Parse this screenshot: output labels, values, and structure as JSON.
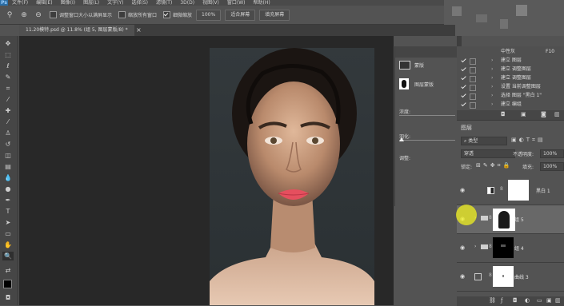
{
  "app": {
    "logo": "Ps"
  },
  "menu": [
    "文件(F)",
    "编辑(E)",
    "图像(I)",
    "图层(L)",
    "文字(Y)",
    "选择(S)",
    "滤镜(T)",
    "3D(D)",
    "视图(V)",
    "窗口(W)",
    "帮助(H)"
  ],
  "options": {
    "resize_windows_label": "调整窗口大小以满屏显示",
    "resize_windows_checked": false,
    "zoom_all_label": "缩放所有窗口",
    "zoom_all_checked": false,
    "scrubby_zoom_label": "细微缩放",
    "scrubby_zoom_checked": true,
    "zoom_value": "100%",
    "fit_screen": "适合屏幕",
    "fill_screen": "填充屏幕"
  },
  "document": {
    "tab": "11.20模特.psd @ 11.8% (组 5, 图层蒙版/8) *"
  },
  "properties": {
    "mask_tab": "蒙版",
    "layer_mask_label": "图层蒙版",
    "density_label": "浓度:",
    "feather_label": "羽化:",
    "adjust_label": "调整:"
  },
  "history": {
    "top_label": "中性灰",
    "top_value": "F10",
    "items": [
      "建立 图层",
      "建立 调整图层",
      "建立 调整图层",
      "设置 当前调整图层",
      "选择 图层 \"黑白 1\"",
      "建立 编组"
    ]
  },
  "layers_panel": {
    "title": "图层",
    "filter_kind": "类型",
    "blend_mode": "穿透",
    "opacity_label": "不透明度:",
    "opacity_value": "100%",
    "lock_label": "锁定:",
    "fill_label": "填充:",
    "fill_value": "100%",
    "layers": [
      {
        "name": "黑白 1"
      },
      {
        "name": "组 5"
      },
      {
        "name": "组 4"
      },
      {
        "name": "曲线 3"
      }
    ]
  },
  "colors": {
    "accent": "#2b6ea5",
    "cursor_highlight": "#f0f020",
    "canvas": "#282828"
  }
}
